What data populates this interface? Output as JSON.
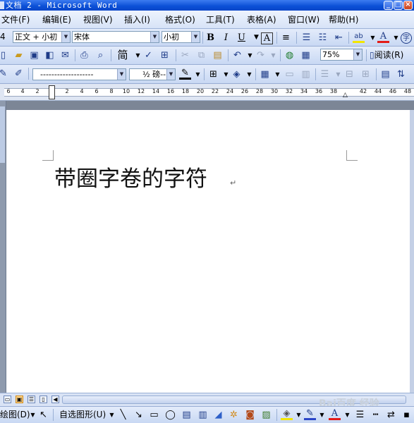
{
  "window": {
    "title": "文档 2 - Microsoft Word"
  },
  "menu": [
    "文件(F)",
    "编辑(E)",
    "视图(V)",
    "插入(I)",
    "格式(O)",
    "工具(T)",
    "表格(A)",
    "窗口(W)",
    "帮助(H)"
  ],
  "formatting": {
    "style_value": "正文 + 小初",
    "font_value": "宋体",
    "size_value": "小初",
    "bold_label": "B",
    "italic_label": "I",
    "underline_label": "U",
    "charborder_label": "A",
    "fontcolor_label": "A"
  },
  "standard": {
    "simplified_label": "简",
    "zoom_value": "75%",
    "read_label": "阅读(R)"
  },
  "drawing_toolbar_top": {
    "line_style_value": "-------------------",
    "weight_value": "½ 磅--"
  },
  "ruler": {
    "ticks": [
      "6",
      "4",
      "2",
      "2",
      "4",
      "6",
      "8",
      "10",
      "12",
      "14",
      "16",
      "18",
      "20",
      "22",
      "24",
      "26",
      "28",
      "30",
      "32",
      "34",
      "36",
      "38",
      "42",
      "44",
      "46",
      "48"
    ]
  },
  "document": {
    "text": "带圈字卷的字符"
  },
  "drawbar": {
    "draw_label": "绘图(D)",
    "autoshape_label": "自选图形(U)"
  },
  "watermark": "Bai百度 经验",
  "colors": {
    "title_bar": "#0a4fd6",
    "toolbar": "#d7e3f7",
    "page": "#ffffff",
    "workspace": "#808a99"
  }
}
